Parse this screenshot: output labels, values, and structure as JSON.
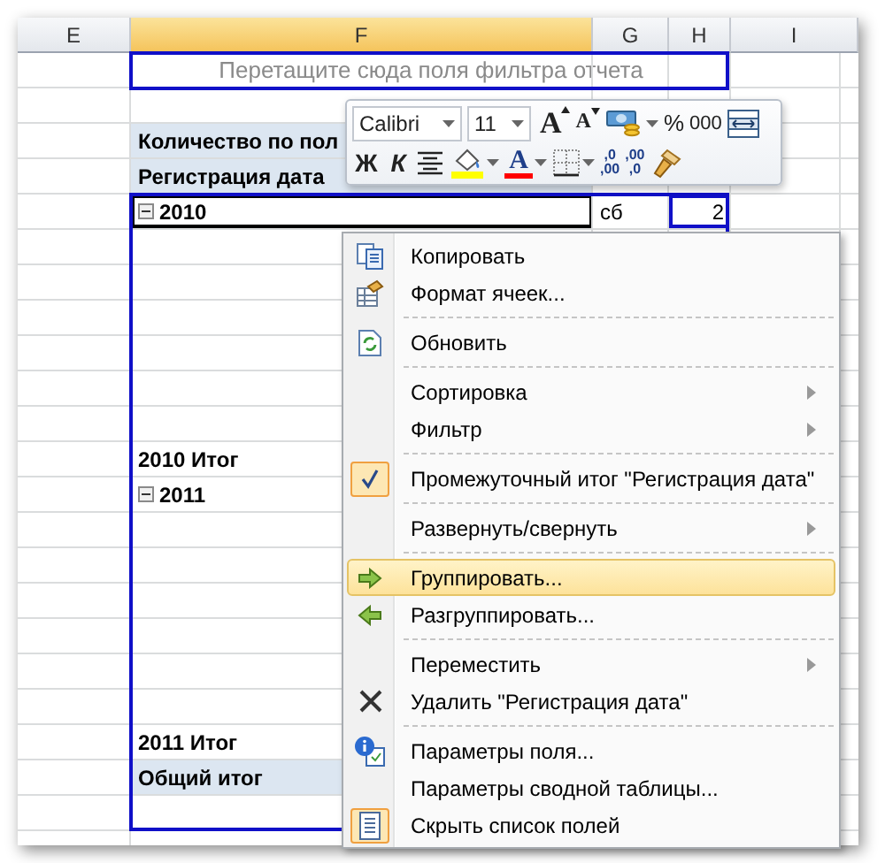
{
  "columns": [
    {
      "label": "E",
      "selected": false
    },
    {
      "label": "F",
      "selected": true
    },
    {
      "label": "G",
      "selected": false
    },
    {
      "label": "H",
      "selected": false
    },
    {
      "label": "I",
      "selected": false
    }
  ],
  "rows": [
    {
      "kind": "filter-drop",
      "f": "Перетащите сюда поля фильтра отчета"
    },
    {},
    {
      "kind": "values-header",
      "f": "Количество по пол"
    },
    {
      "kind": "field-header",
      "f": "Регистрация дата"
    },
    {
      "kind": "group",
      "f": "2010",
      "expanded": true,
      "selected": true,
      "g": "сб",
      "h": "2"
    },
    {},
    {},
    {},
    {},
    {},
    {},
    {
      "kind": "subtotal",
      "f": "2010 Итог"
    },
    {
      "kind": "group",
      "f": "2011",
      "expanded": true,
      "selected": false
    },
    {},
    {},
    {},
    {},
    {},
    {},
    {
      "kind": "subtotal",
      "f": "2011 Итог"
    },
    {
      "kind": "grand-total",
      "f": "Общий итог"
    },
    {}
  ],
  "mini_toolbar": {
    "font": "Calibri",
    "size": "11",
    "row_1": [
      {
        "kind": "grow-font",
        "text": "A"
      },
      {
        "kind": "shrink-font",
        "text": "A"
      },
      {
        "kind": "currency"
      },
      {
        "kind": "percent",
        "text": "%"
      },
      {
        "kind": "thousands",
        "text": "000"
      },
      {
        "kind": "merge"
      }
    ],
    "row_2": [
      {
        "kind": "bold",
        "text": "Ж"
      },
      {
        "kind": "italic",
        "text": "К"
      },
      {
        "kind": "align-center"
      },
      {
        "kind": "fill-color",
        "color": "#ffff00"
      },
      {
        "kind": "font-color",
        "text": "A",
        "color": "#ff0000"
      },
      {
        "kind": "borders"
      },
      {
        "kind": "increase-decimal",
        "text": ",0",
        "text_2": ",00"
      },
      {
        "kind": "decrease-decimal",
        "text": ",00",
        "text_2": ",0"
      },
      {
        "kind": "format-painter"
      }
    ]
  },
  "context_menu": [
    {
      "label": "Копировать",
      "kind": "copy",
      "checked": false,
      "selected": false,
      "submenu": false,
      "separator_after": false
    },
    {
      "label": "Формат ячеек...",
      "kind": "format",
      "checked": false,
      "selected": false,
      "submenu": false,
      "separator_after": true
    },
    {
      "label": "Обновить",
      "kind": "refresh",
      "checked": false,
      "selected": false,
      "submenu": false,
      "separator_after": true
    },
    {
      "label": "Сортировка",
      "checked": false,
      "selected": false,
      "submenu": true,
      "separator_after": false
    },
    {
      "label": "Фильтр",
      "checked": false,
      "selected": false,
      "submenu": true,
      "separator_after": true
    },
    {
      "label": "Промежуточный итог \"Регистрация дата\"",
      "kind": "check",
      "checked": true,
      "selected": false,
      "submenu": false,
      "separator_after": true
    },
    {
      "label": "Развернуть/свернуть",
      "checked": false,
      "selected": false,
      "submenu": true,
      "separator_after": true
    },
    {
      "label": "Группировать...",
      "kind": "group",
      "checked": false,
      "selected": true,
      "submenu": false,
      "separator_after": false
    },
    {
      "label": "Разгруппировать...",
      "kind": "ungroup",
      "checked": false,
      "selected": false,
      "submenu": false,
      "separator_after": true
    },
    {
      "label": "Переместить",
      "checked": false,
      "selected": false,
      "submenu": true,
      "separator_after": false
    },
    {
      "label": "Удалить \"Регистрация дата\"",
      "kind": "delete",
      "checked": false,
      "selected": false,
      "submenu": false,
      "separator_after": true
    },
    {
      "label": "Параметры поля...",
      "kind": "info",
      "checked": false,
      "selected": false,
      "submenu": false,
      "separator_after": false
    },
    {
      "label": "Параметры сводной таблицы...",
      "checked": false,
      "selected": false,
      "submenu": false,
      "separator_after": false
    },
    {
      "label": "Скрыть список полей",
      "kind": "field-list",
      "checked": true,
      "selected": false,
      "submenu": false,
      "separator_after": false
    }
  ]
}
